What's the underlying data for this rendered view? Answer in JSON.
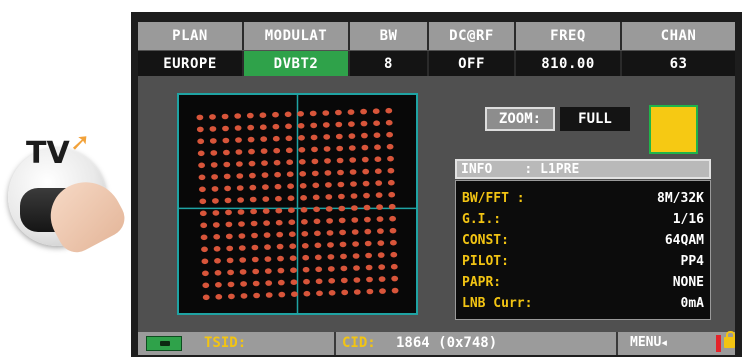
{
  "tv_button": {
    "label": "TV",
    "icon": "remote-button-with-finger-icon"
  },
  "header": {
    "columns": [
      {
        "label": "PLAN",
        "value": "EUROPE"
      },
      {
        "label": "MODULAT",
        "value": "DVBT2"
      },
      {
        "label": "BW",
        "value": "8"
      },
      {
        "label": "DC@RF",
        "value": "OFF"
      },
      {
        "label": "FREQ",
        "value": "810.00"
      },
      {
        "label": "CHAN",
        "value": "63"
      }
    ]
  },
  "constellation": {
    "type": "64QAM-rotated",
    "point_color": "#d8553a",
    "grid_color": "#1fa3a3",
    "rows": 16,
    "cols": 16
  },
  "zoom": {
    "label": "ZOOM:",
    "value": "FULL"
  },
  "lock_indicator": {
    "color": "#f6c913"
  },
  "info": {
    "title": "INFO",
    "separator": ":",
    "section": "L1PRE",
    "rows": [
      {
        "key": "BW/FFT :",
        "value": "8M/32K"
      },
      {
        "key": "G.I.:",
        "value": "1/16"
      },
      {
        "key": "CONST:",
        "value": "64QAM"
      },
      {
        "key": "PILOT:",
        "value": "PP4"
      },
      {
        "key": "PAPR:",
        "value": "NONE"
      },
      {
        "key": "LNB Curr:",
        "value": "0mA"
      }
    ]
  },
  "status_bar": {
    "battery_icon": "battery-plug-icon",
    "tsid_label": "TSID:",
    "tsid_value": "",
    "cid_label": "CID:",
    "cid_value": "1864 (0x748)",
    "menu_label": "MENU",
    "menu_icon": "arrow-left-icon",
    "lock_icon": "padlock-icon"
  },
  "colors": {
    "accent_green": "#2fa24a",
    "accent_yellow": "#f2c413",
    "alert_red": "#e4232a"
  }
}
